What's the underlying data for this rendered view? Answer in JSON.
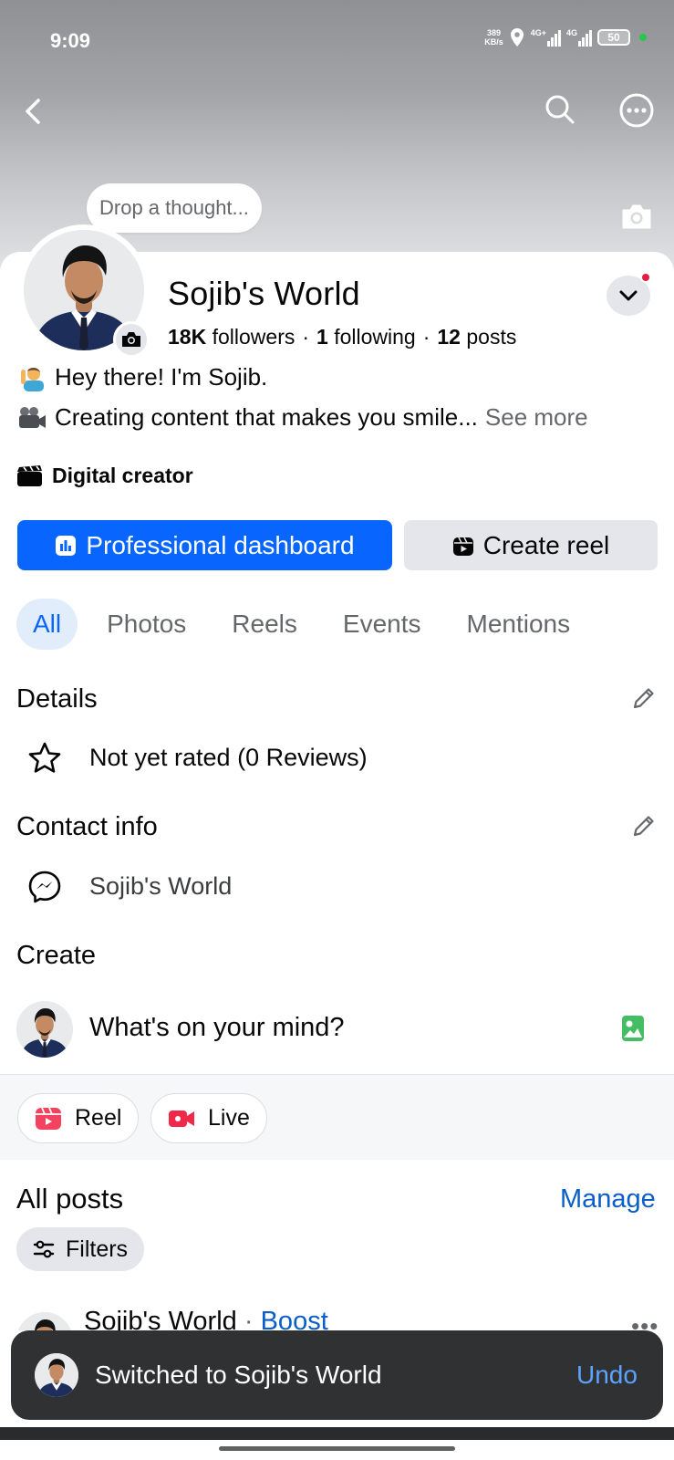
{
  "status": {
    "time": "9:09",
    "net_speed_value": "389",
    "net_speed_unit": "KB/s",
    "signal1_label": "4G+",
    "signal2_label": "4G",
    "battery": "50"
  },
  "cover": {
    "thought_placeholder": "Drop a thought..."
  },
  "profile": {
    "name": "Sojib's World",
    "followers_count": "18K",
    "followers_label": "followers",
    "following_count": "1",
    "following_label": "following",
    "posts_count": "12",
    "posts_label": "posts",
    "stats_separator": "·",
    "bio_line1": "Hey there! I'm Sojib.",
    "bio_line2": "Creating content that makes you smile...",
    "see_more": "See more",
    "category": "Digital creator"
  },
  "actions": {
    "professional_dashboard": "Professional dashboard",
    "create_reel": "Create reel"
  },
  "tabs": [
    {
      "label": "All",
      "active": true
    },
    {
      "label": "Photos",
      "active": false
    },
    {
      "label": "Reels",
      "active": false
    },
    {
      "label": "Events",
      "active": false
    },
    {
      "label": "Mentions",
      "active": false
    }
  ],
  "details": {
    "title": "Details",
    "rating": "Not yet rated (0 Reviews)"
  },
  "contact": {
    "title": "Contact info",
    "messenger": "Sojib's World"
  },
  "create": {
    "title": "Create",
    "prompt": "What's on your mind?",
    "chip_reel": "Reel",
    "chip_live": "Live"
  },
  "posts": {
    "title": "All posts",
    "manage": "Manage",
    "filters": "Filters",
    "first_post_author": "Sojib's World",
    "first_post_separator": "·",
    "first_post_boost": "Boost"
  },
  "toast": {
    "message": "Switched to Sojib's World",
    "undo": "Undo"
  },
  "colors": {
    "accent": "#0866ff",
    "link": "#0a5ec7",
    "notification": "#e41e3f",
    "toast_bg": "#303133"
  },
  "icons": [
    "back-icon",
    "search-icon",
    "more-icon",
    "camera-icon",
    "chevron-down-icon",
    "star-icon",
    "messenger-icon",
    "edit-icon",
    "photo-icon",
    "reel-icon",
    "live-icon",
    "filter-icon",
    "dashboard-icon",
    "clapper-icon"
  ]
}
